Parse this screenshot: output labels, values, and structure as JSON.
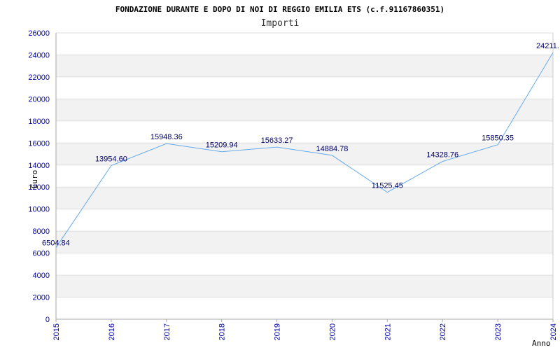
{
  "chart_data": {
    "type": "line",
    "title": "FONDAZIONE DURANTE E DOPO DI NOI DI REGGIO EMILIA ETS (c.f.91167860351)",
    "subtitle": "Importi",
    "xlabel": "Anno",
    "ylabel": "Euro",
    "x": [
      "2015",
      "2016",
      "2017",
      "2018",
      "2019",
      "2020",
      "2021",
      "2022",
      "2023",
      "2024"
    ],
    "series": [
      {
        "values": [
          6504.84,
          13954.6,
          15948.36,
          15209.94,
          15633.27,
          14884.78,
          11525.45,
          14328.76,
          15850.35,
          24211.0
        ],
        "labels": [
          "6504.84",
          "13954.60",
          "15948.36",
          "15209.94",
          "15633.27",
          "14884.78",
          "11525.45",
          "14328.76",
          "15850.35",
          "24211."
        ]
      }
    ],
    "ylim": [
      0,
      26000
    ],
    "yticks": [
      "0",
      "2000",
      "4000",
      "6000",
      "8000",
      "10000",
      "12000",
      "14000",
      "16000",
      "18000",
      "20000",
      "22000",
      "24000",
      "26000"
    ],
    "grid": true,
    "colors": {
      "line": "#66aaee",
      "band": "#f2f2f2",
      "gridline": "#dddddd",
      "tick_text": "#0000aa",
      "label_text": "#000066"
    }
  }
}
